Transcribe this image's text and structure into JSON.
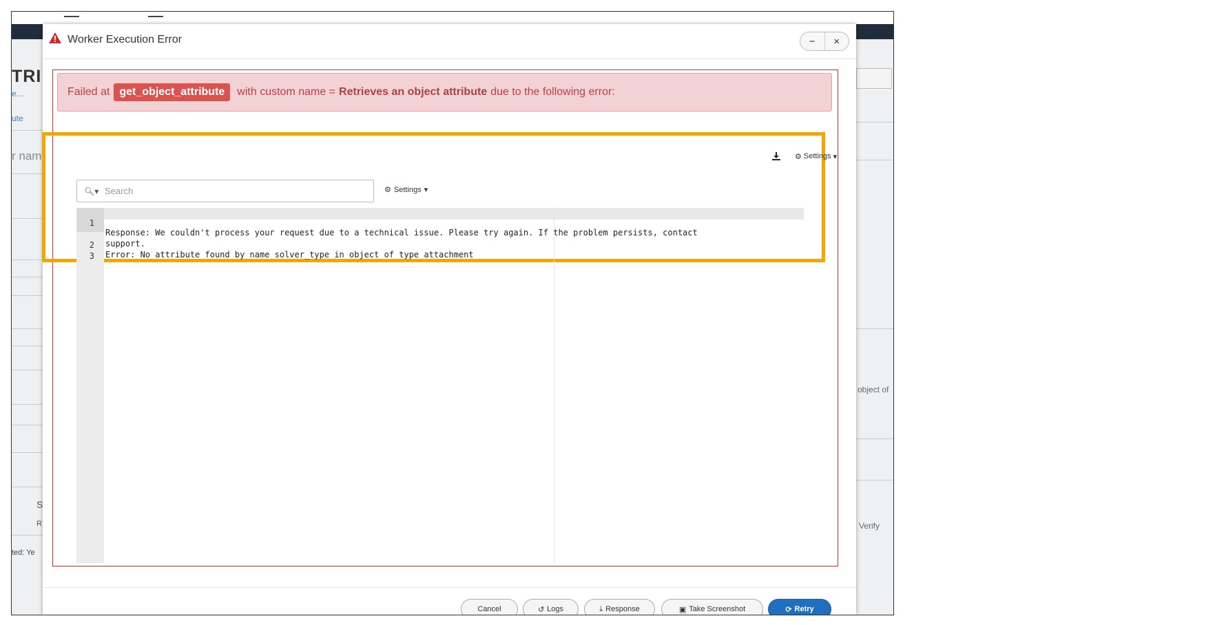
{
  "dialog": {
    "title": "Worker Execution Error"
  },
  "window_controls": {
    "minimize": "−",
    "close": "×"
  },
  "alert": {
    "prefix": "Failed at",
    "step_name": "get_object_attribute",
    "middle": "with custom name =",
    "custom_name": "Retrieves an object attribute",
    "suffix": "due to the following error:"
  },
  "toolbar": {
    "settings_label": "Settings"
  },
  "search": {
    "placeholder": "Search",
    "settings_label": "Settings"
  },
  "editor": {
    "lines": [
      {
        "number": "1",
        "text": "Response: We couldn't process your request due to a technical issue. Please try again. If the problem persists, contact"
      },
      {
        "number": "",
        "text": "support."
      },
      {
        "number": "2",
        "text": "Error: No attribute found by name solver_type in object of type attachment"
      },
      {
        "number": "3",
        "text": ""
      }
    ]
  },
  "footer": {
    "cancel": "Cancel",
    "logs": "Logs",
    "response": "Response",
    "screenshot": "Take Screenshot",
    "retry": "Retry"
  },
  "background": {
    "brand_fragment": "TRI",
    "link_1": "e...",
    "link_2": "ute",
    "field_fragment": "r nam",
    "right_fragment": "object of",
    "left_bottom_fragment": "ted: Ye",
    "letter_s": "S",
    "letter_r": "R",
    "verify": "Verify"
  },
  "colors": {
    "alert_bg": "#f2d2d5",
    "badge": "#d9534f",
    "retry": "#1f6fbf",
    "highlight_box": "#f5a500",
    "error_box": "#d72c2c"
  }
}
